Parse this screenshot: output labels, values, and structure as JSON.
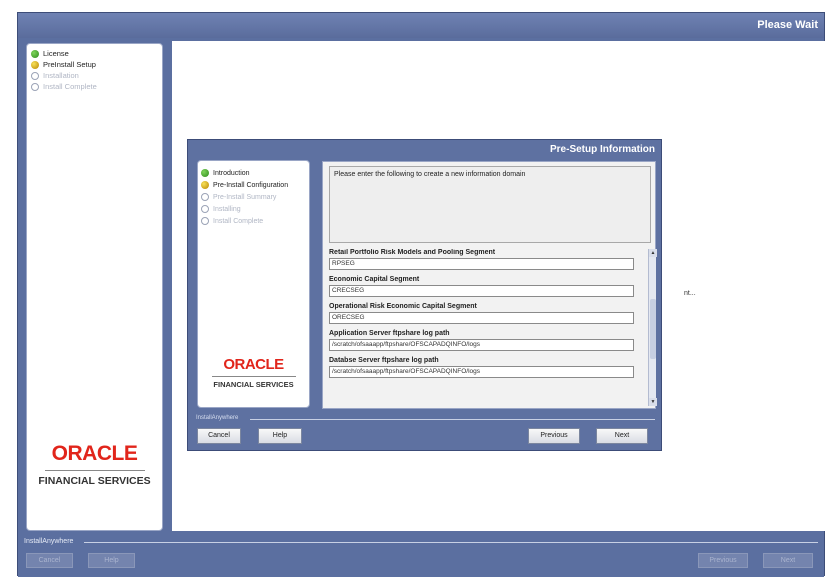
{
  "outer": {
    "title": "Please Wait",
    "steps": [
      {
        "label": "License",
        "state": "done"
      },
      {
        "label": "PreInstall Setup",
        "state": "current"
      },
      {
        "label": "Installation",
        "state": "pending"
      },
      {
        "label": "Install Complete",
        "state": "pending"
      }
    ],
    "logo_oracle": "ORACLE",
    "logo_fs": "FINANCIAL SERVICES",
    "main_text": "nt...",
    "footer_label": "InstallAnywhere",
    "buttons": {
      "cancel": "Cancel",
      "help": "Help",
      "previous": "Previous",
      "next": "Next"
    }
  },
  "dialog": {
    "title": "Pre-Setup Information",
    "steps": [
      {
        "label": "Introduction",
        "state": "done"
      },
      {
        "label": "Pre-Install Configuration",
        "state": "current"
      },
      {
        "label": "Pre-Install Summary",
        "state": "pending"
      },
      {
        "label": "Installing",
        "state": "pending"
      },
      {
        "label": "Install Complete",
        "state": "pending"
      }
    ],
    "logo_oracle": "ORACLE",
    "logo_fs": "FINANCIAL SERVICES",
    "intro_text": "Please enter the following to create a new information domain",
    "fields": [
      {
        "label": "Retail Portfolio Risk Models and Pooling Segment",
        "value": "RPSEG"
      },
      {
        "label": "Economic Capital Segment",
        "value": "CRECSEG"
      },
      {
        "label": "Operational Risk Economic Capital Segment",
        "value": "ORECSEG"
      },
      {
        "label": "Application Server ftpshare log path",
        "value": "/scratch/ofsaaapp/ftpshare/OFSCAPADQINFO/logs"
      },
      {
        "label": "Databse Server ftpshare log path",
        "value": "/scratch/ofsaaapp/ftpshare/OFSCAPADQINFO/logs"
      }
    ],
    "footer_label": "InstallAnywhere",
    "buttons": {
      "cancel": "Cancel",
      "help": "Help",
      "previous": "Previous",
      "next": "Next"
    }
  }
}
